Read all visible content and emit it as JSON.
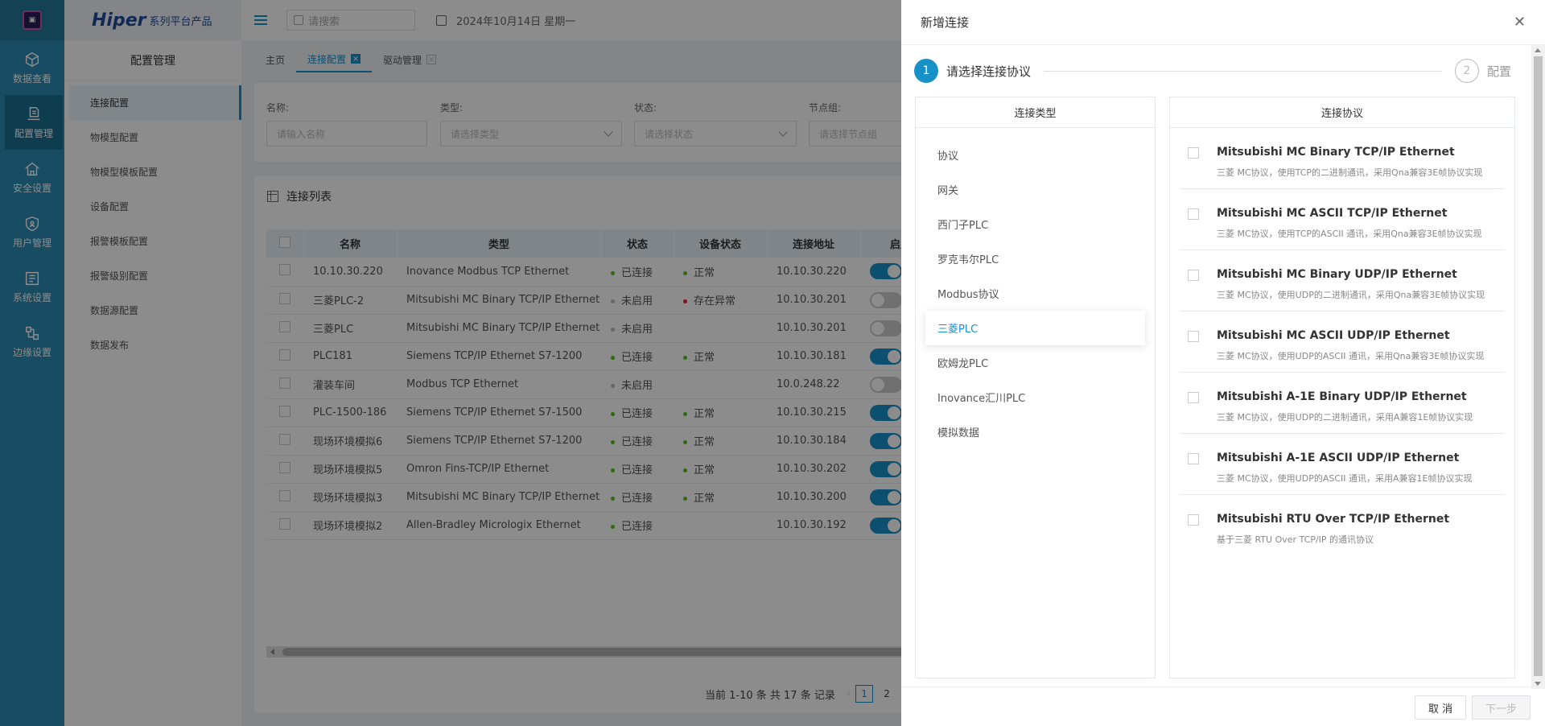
{
  "rail": {
    "items": [
      {
        "label": "数据查看",
        "icon": "cube-icon"
      },
      {
        "label": "配置管理",
        "icon": "config-icon"
      },
      {
        "label": "安全设置",
        "icon": "security-icon"
      },
      {
        "label": "用户管理",
        "icon": "user-shield-icon"
      },
      {
        "label": "系统设置",
        "icon": "system-icon"
      },
      {
        "label": "边缘设置",
        "icon": "edge-icon"
      }
    ]
  },
  "brand": {
    "name": "Hiper",
    "suffix": "系列平台产品"
  },
  "sidebar": {
    "title": "配置管理",
    "items": [
      "连接配置",
      "物模型配置",
      "物模型模板配置",
      "设备配置",
      "报警模板配置",
      "报警级别配置",
      "数据源配置",
      "数据发布"
    ]
  },
  "topbar": {
    "search_placeholder": "请搜索",
    "date": "2024年10月14日 星期一"
  },
  "tabs": [
    "主页",
    "连接配置",
    "驱动管理"
  ],
  "filters": [
    {
      "label": "名称:",
      "placeholder": "请输入名称"
    },
    {
      "label": "类型:",
      "placeholder": "请选择类型"
    },
    {
      "label": "状态:",
      "placeholder": "请选择状态"
    },
    {
      "label": "节点组:",
      "placeholder": "请选择节点组"
    }
  ],
  "list": {
    "title": "连接列表",
    "columns": [
      "名称",
      "类型",
      "状态",
      "设备状态",
      "连接地址",
      "启用"
    ],
    "rows": [
      {
        "name": "10.10.30.220",
        "type": "Inovance Modbus TCP Ethernet",
        "status": "已连接",
        "device": "正常",
        "addr": "10.10.30.220",
        "on": true
      },
      {
        "name": "三菱PLC-2",
        "type": "Mitsubishi MC Binary TCP/IP Ethernet",
        "status": "未启用",
        "device": "存在异常",
        "addr": "10.10.30.201",
        "on": false
      },
      {
        "name": "三菱PLC",
        "type": "Mitsubishi MC Binary TCP/IP Ethernet",
        "status": "未启用",
        "device": "",
        "addr": "10.10.30.201",
        "on": false
      },
      {
        "name": "PLC181",
        "type": "Siemens TCP/IP Ethernet S7-1200",
        "status": "已连接",
        "device": "正常",
        "addr": "10.10.30.181",
        "on": true
      },
      {
        "name": "灌装车间",
        "type": "Modbus TCP Ethernet",
        "status": "未启用",
        "device": "",
        "addr": "10.0.248.22",
        "on": false
      },
      {
        "name": "PLC-1500-186",
        "type": "Siemens TCP/IP Ethernet S7-1500",
        "status": "已连接",
        "device": "正常",
        "addr": "10.10.30.215",
        "on": true
      },
      {
        "name": "现场环境模拟6",
        "type": "Siemens TCP/IP Ethernet S7-1200",
        "status": "已连接",
        "device": "正常",
        "addr": "10.10.30.184",
        "on": true
      },
      {
        "name": "现场环境模拟5",
        "type": "Omron Fins-TCP/IP Ethernet",
        "status": "已连接",
        "device": "正常",
        "addr": "10.10.30.202",
        "on": true
      },
      {
        "name": "现场环境模拟3",
        "type": "Mitsubishi MC Binary TCP/IP Ethernet",
        "status": "已连接",
        "device": "正常",
        "addr": "10.10.30.200",
        "on": true
      },
      {
        "name": "现场环境模拟2",
        "type": "Allen-Bradley Micrologix Ethernet",
        "status": "已连接",
        "device": "",
        "addr": "10.10.30.192",
        "on": true
      }
    ],
    "pager_text": "当前 1-10 条 共 17 条 记录",
    "pages": [
      "1",
      "2"
    ]
  },
  "colors": {
    "accent": "#1890c8",
    "ok": "#52c41a",
    "error": "#f5222d",
    "disabled": "#bbbbbb"
  },
  "drawer": {
    "title": "新增连接",
    "step1": {
      "num": "1",
      "label": "请选择连接协议"
    },
    "step2": {
      "num": "2",
      "label": "配置"
    },
    "type_header": "连接类型",
    "protocol_header": "连接协议",
    "types": [
      "协议",
      "网关",
      "西门子PLC",
      "罗克韦尔PLC",
      "Modbus协议",
      "三菱PLC",
      "欧姆龙PLC",
      "Inovance汇川PLC",
      "模拟数据"
    ],
    "selected_type": "三菱PLC",
    "protocols": [
      {
        "name": "Mitsubishi MC Binary TCP/IP Ethernet",
        "desc": "三菱 MC协议，使用TCP的二进制通讯，采用Qna兼容3E帧协议实现"
      },
      {
        "name": "Mitsubishi MC ASCII TCP/IP Ethernet",
        "desc": "三菱 MC协议，使用TCP的ASCII 通讯，采用Qna兼容3E帧协议实现"
      },
      {
        "name": "Mitsubishi MC Binary UDP/IP Ethernet",
        "desc": "三菱 MC协议，使用UDP的二进制通讯，采用Qna兼容3E帧协议实现"
      },
      {
        "name": "Mitsubishi MC ASCII UDP/IP Ethernet",
        "desc": "三菱 MC协议，使用UDP的ASCII 通讯，采用Qna兼容3E帧协议实现"
      },
      {
        "name": "Mitsubishi A-1E Binary UDP/IP Ethernet",
        "desc": "三菱 MC协议，使用UDP的二进制通讯，采用A兼容1E帧协议实现"
      },
      {
        "name": "Mitsubishi A-1E ASCII UDP/IP Ethernet",
        "desc": "三菱 MC协议，使用UDP的ASCII 通讯，采用A兼容1E帧协议实现"
      },
      {
        "name": "Mitsubishi RTU Over TCP/IP Ethernet",
        "desc": "基于三菱 RTU Over TCP/IP 的通讯协议"
      }
    ],
    "cancel": "取 消",
    "next": "下一步"
  }
}
